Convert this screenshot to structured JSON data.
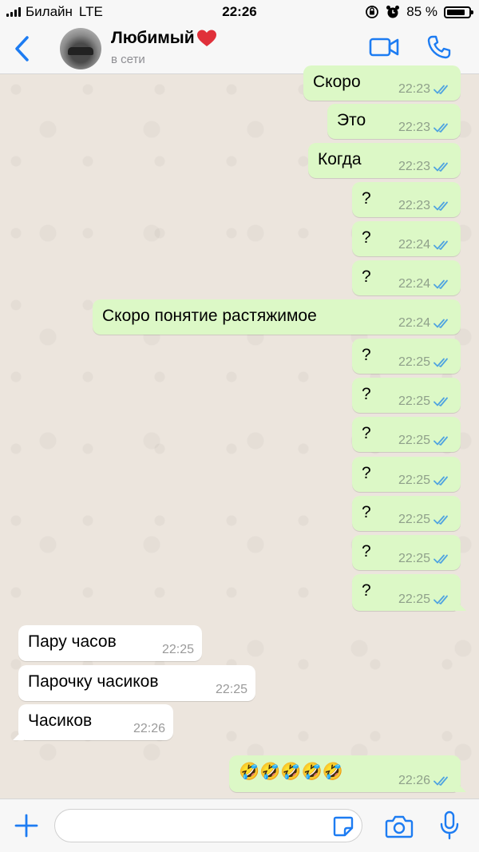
{
  "status_bar": {
    "carrier": "Билайн",
    "network": "LTE",
    "time": "22:26",
    "battery_percent": "85 %",
    "battery_level": 0.85,
    "icons": [
      "signal-bars-icon",
      "orientation-lock-icon",
      "alarm-icon",
      "battery-icon"
    ]
  },
  "header": {
    "contact_name": "Любимый",
    "contact_emoji": "heart-icon",
    "presence": "в сети",
    "back_icon": "chevron-left-icon",
    "video_icon": "video-call-icon",
    "call_icon": "phone-icon"
  },
  "colors": {
    "accent": "#1d7cf2",
    "outgoing_bubble": "#dcf8c6",
    "incoming_bubble": "#ffffff",
    "read_ticks": "#4fa3e0",
    "wallpaper": "#ece5dd"
  },
  "messages": [
    {
      "direction": "out",
      "text": "Скоро",
      "time": "22:23",
      "read": true
    },
    {
      "direction": "out",
      "text": "Это",
      "time": "22:23",
      "read": true
    },
    {
      "direction": "out",
      "text": "Когда",
      "time": "22:23",
      "read": true
    },
    {
      "direction": "out",
      "text": "?",
      "time": "22:23",
      "read": true
    },
    {
      "direction": "out",
      "text": "?",
      "time": "22:24",
      "read": true
    },
    {
      "direction": "out",
      "text": "?",
      "time": "22:24",
      "read": true
    },
    {
      "direction": "out",
      "text": "Скоро понятие растяжимое",
      "time": "22:24",
      "read": true
    },
    {
      "direction": "out",
      "text": "?",
      "time": "22:25",
      "read": true
    },
    {
      "direction": "out",
      "text": "?",
      "time": "22:25",
      "read": true
    },
    {
      "direction": "out",
      "text": "?",
      "time": "22:25",
      "read": true
    },
    {
      "direction": "out",
      "text": "?",
      "time": "22:25",
      "read": true
    },
    {
      "direction": "out",
      "text": "?",
      "time": "22:25",
      "read": true
    },
    {
      "direction": "out",
      "text": "?",
      "time": "22:25",
      "read": true
    },
    {
      "direction": "out",
      "text": "?",
      "time": "22:25",
      "read": true
    },
    {
      "direction": "in",
      "text": "Пару часов",
      "time": "22:25"
    },
    {
      "direction": "in",
      "text": "Парочку часиков",
      "time": "22:25"
    },
    {
      "direction": "in",
      "text": "Часиков",
      "time": "22:26"
    },
    {
      "direction": "out",
      "text": "🤣🤣🤣🤣🤣",
      "time": "22:26",
      "read": true
    }
  ],
  "input_bar": {
    "placeholder": "",
    "value": "",
    "icons": [
      "plus-icon",
      "sticker-icon",
      "camera-icon",
      "microphone-icon"
    ]
  }
}
